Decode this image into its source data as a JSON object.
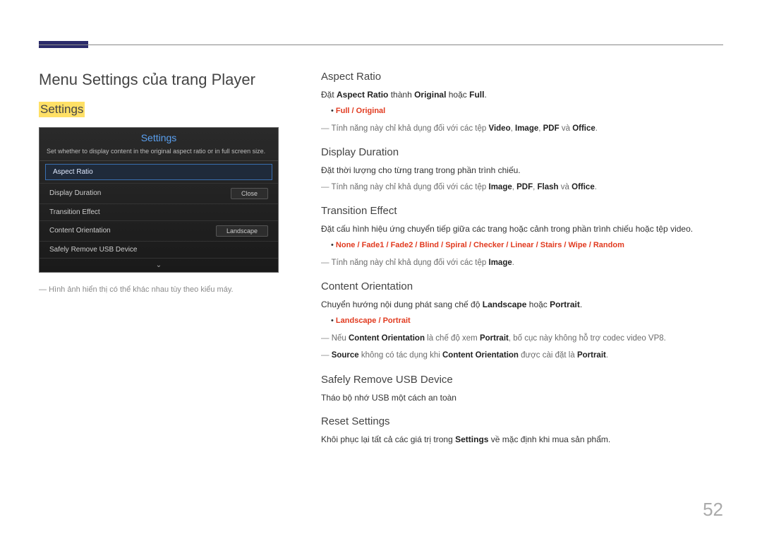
{
  "page_number": "52",
  "page_title": "Menu Settings của trang Player",
  "settings_label": "Settings",
  "panel": {
    "title": "Settings",
    "description": "Set whether to display content in the original aspect ratio or in full screen size.",
    "items": [
      {
        "label": "Aspect Ratio",
        "value": "",
        "selected": true
      },
      {
        "label": "Display Duration",
        "value": "Close"
      },
      {
        "label": "Transition Effect",
        "value": ""
      },
      {
        "label": "Content Orientation",
        "value": "Landscape"
      },
      {
        "label": "Safely Remove USB Device",
        "value": ""
      }
    ],
    "arrow": "⌄"
  },
  "left_note": "Hình ảnh hiển thị có thể khác nhau tùy theo kiểu máy.",
  "sections": {
    "aspect_ratio": {
      "heading": "Aspect Ratio",
      "line1_a": "Đặt ",
      "line1_b": "Aspect Ratio",
      "line1_c": " thành ",
      "line1_d": "Original",
      "line1_e": " hoặc ",
      "line1_f": "Full",
      "line1_g": ".",
      "bullet_a": "Full",
      "bullet_sep": " / ",
      "bullet_b": "Original",
      "note_a": "Tính năng này chỉ khả dụng đối với các tệp ",
      "note_b": "Video",
      "note_c": ", ",
      "note_d": "Image",
      "note_e": ", ",
      "note_f": "PDF",
      "note_g": " và ",
      "note_h": "Office",
      "note_i": "."
    },
    "display_duration": {
      "heading": "Display Duration",
      "line": "Đặt thời lượng cho từng trang trong phần trình chiếu.",
      "note_a": "Tính năng này chỉ khả dụng đối với các tệp ",
      "note_b": "Image",
      "note_c": ", ",
      "note_d": "PDF",
      "note_e": ", ",
      "note_f": "Flash",
      "note_g": " và ",
      "note_h": "Office",
      "note_i": "."
    },
    "transition_effect": {
      "heading": "Transition Effect",
      "line": "Đặt cấu hình hiệu ứng chuyển tiếp giữa các trang hoặc cảnh trong phần trình chiếu hoặc tệp video.",
      "opts": [
        "None",
        "Fade1",
        "Fade2",
        "Blind",
        "Spiral",
        "Checker",
        "Linear",
        "Stairs",
        "Wipe",
        "Random"
      ],
      "opt_sep": " / ",
      "note_a": "Tính năng này chỉ khả dụng đối với các tệp ",
      "note_b": "Image",
      "note_c": "."
    },
    "content_orientation": {
      "heading": "Content Orientation",
      "line_a": "Chuyển hướng nội dung phát sang chế độ ",
      "line_b": "Landscape",
      "line_c": " hoặc ",
      "line_d": "Portrait",
      "line_e": ".",
      "bullet_a": "Landscape",
      "bullet_sep": " / ",
      "bullet_b": "Portrait",
      "note1_a": "Nếu ",
      "note1_b": "Content Orientation",
      "note1_c": " là chế độ xem ",
      "note1_d": "Portrait",
      "note1_e": ", bố cục này không hỗ trợ codec video VP8.",
      "note2_a": "Source",
      "note2_b": " không có tác dụng khi ",
      "note2_c": "Content Orientation",
      "note2_d": " được cài đặt là ",
      "note2_e": "Portrait",
      "note2_f": "."
    },
    "safely_remove": {
      "heading": "Safely Remove USB Device",
      "line": "Tháo bộ nhớ USB một cách an toàn"
    },
    "reset": {
      "heading": "Reset Settings",
      "line_a": "Khôi phục lại tất cả các giá trị trong ",
      "line_b": "Settings",
      "line_c": " về mặc định khi mua sản phẩm."
    }
  }
}
